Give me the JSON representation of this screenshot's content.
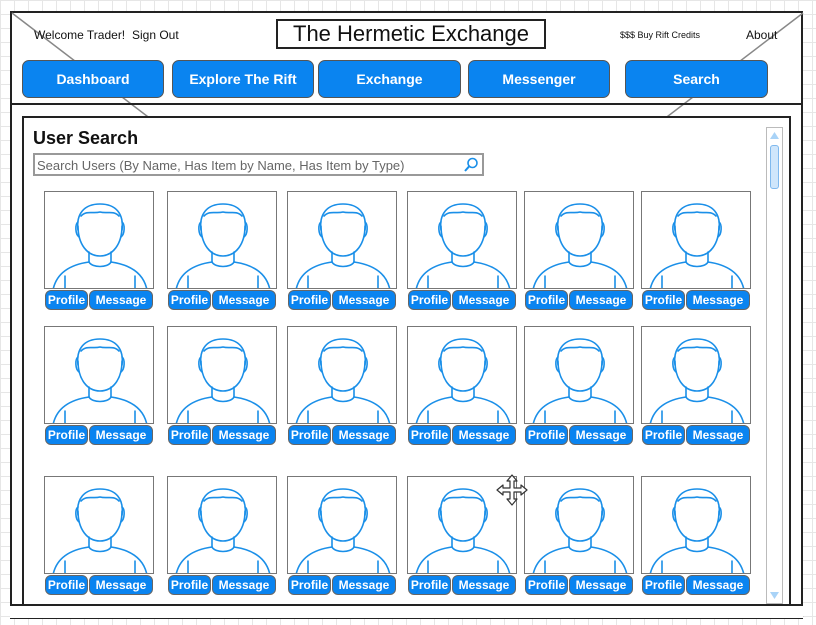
{
  "header": {
    "welcome_text": "Welcome Trader!",
    "sign_out_label": "Sign Out",
    "title": "The Hermetic Exchange",
    "buy_credits_label": "$$$ Buy Rift Credits",
    "about_label": "About"
  },
  "nav": {
    "items": [
      {
        "label": "Dashboard"
      },
      {
        "label": "Explore The Rift"
      },
      {
        "label": "Exchange"
      },
      {
        "label": "Messenger"
      },
      {
        "label": "Search"
      }
    ]
  },
  "search": {
    "section_title": "User Search",
    "placeholder": "Search Users (By Name, Has Item by Name, Has Item by Type)"
  },
  "results": {
    "profile_label": "Profile",
    "message_label": "Message",
    "count": 18,
    "avatar_icon": "user-avatar-icon"
  },
  "colors": {
    "accent": "#0a84f0",
    "avatar_stroke": "#1a8fe8"
  }
}
